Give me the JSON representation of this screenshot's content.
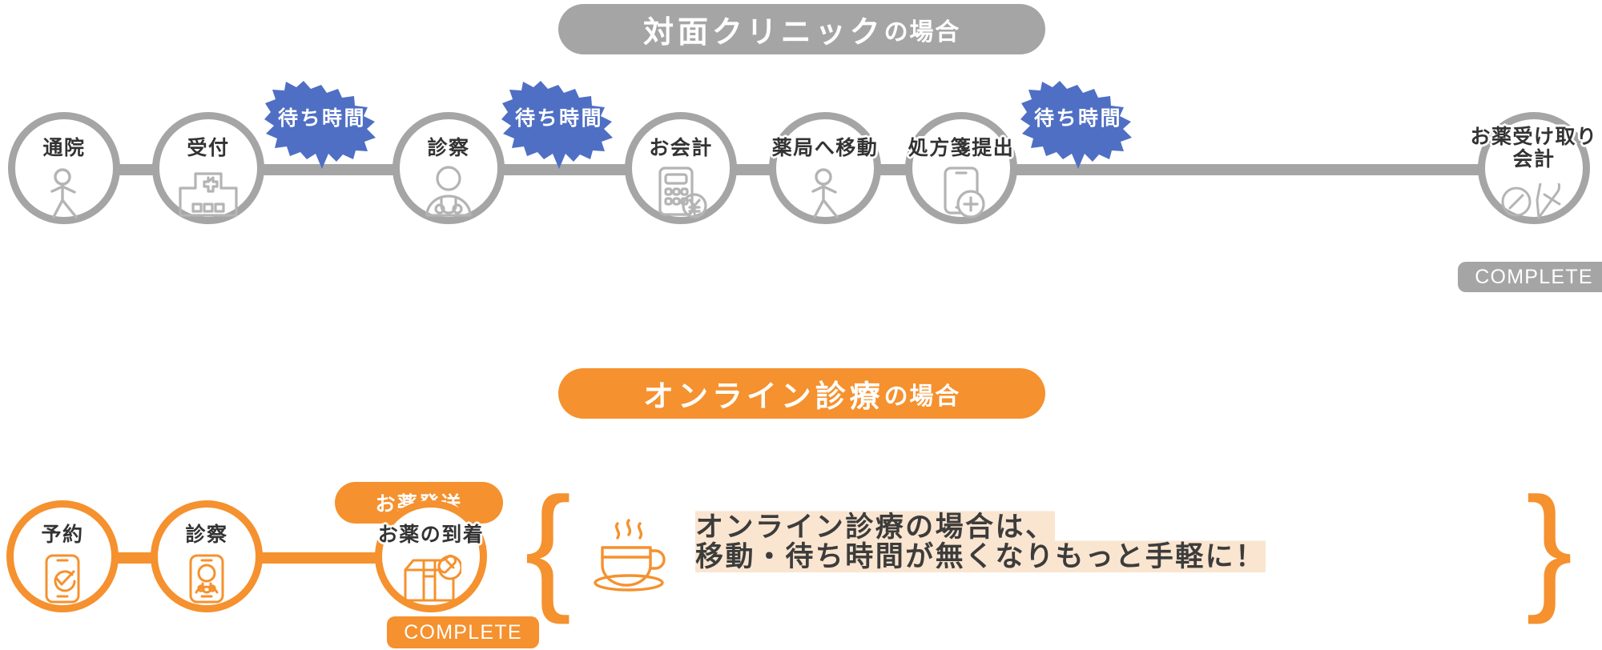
{
  "sections": {
    "offline": {
      "header_main": "対面クリニック",
      "header_suffix": "の場合",
      "accent": "#a5a5a5",
      "badge_color": "#4f6fc4",
      "complete_label": "COMPLETE",
      "waiting_label": "待ち時間",
      "steps": [
        {
          "label": "通院",
          "icon": "walking-person-icon"
        },
        {
          "label": "受付",
          "icon": "hospital-building-icon"
        },
        {
          "label": "診察",
          "icon": "doctor-icon"
        },
        {
          "label": "お会計",
          "icon": "calculator-yen-icon"
        },
        {
          "label": "薬局へ移動",
          "icon": "walking-person-icon"
        },
        {
          "label": "処方箋提出",
          "icon": "phone-prescription-icon"
        },
        {
          "label_line1": "お薬受け取り",
          "label_line2": "会計",
          "icon": "pills-icon"
        }
      ],
      "waiting_badges": [
        "待ち時間",
        "待ち時間",
        "待ち時間"
      ]
    },
    "online": {
      "header_main": "オンライン診療",
      "header_suffix": "の場合",
      "accent": "#f5912e",
      "complete_label": "COMPLETE",
      "shipping_label": "お薬発送",
      "steps": [
        {
          "label": "予約",
          "icon": "phone-check-icon"
        },
        {
          "label": "診察",
          "icon": "phone-doctor-icon"
        },
        {
          "label": "お薬の到着",
          "icon": "package-pill-icon"
        }
      ],
      "note": {
        "line1": "オンライン診療の場合は、",
        "line2": "移動・待ち時間が無くなりもっと手軽に！",
        "highlight_color": "#fae5d0",
        "icon": "coffee-cup-icon",
        "brace_open": "{",
        "brace_close": "}"
      }
    }
  }
}
